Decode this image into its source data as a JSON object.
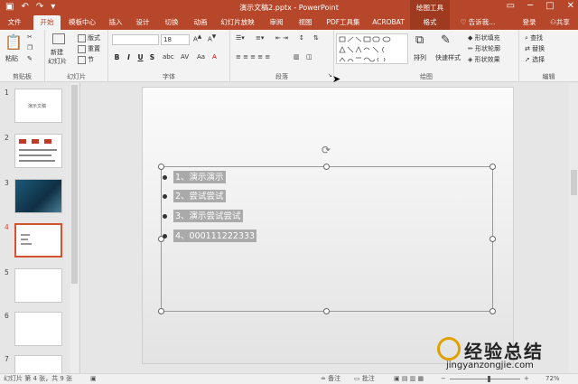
{
  "titlebar": {
    "save_icon": "save-icon",
    "undo": "↶",
    "redo": "↷",
    "title": "演示文稿2.pptx - PowerPoint",
    "context": "绘图工具"
  },
  "tabs": {
    "items": [
      {
        "label": "文件"
      },
      {
        "label": "开始",
        "active": true
      },
      {
        "label": "模板中心"
      },
      {
        "label": "插入"
      },
      {
        "label": "设计"
      },
      {
        "label": "切换"
      },
      {
        "label": "动画"
      },
      {
        "label": "幻灯片放映"
      },
      {
        "label": "审阅"
      },
      {
        "label": "视图"
      },
      {
        "label": "PDF工具集"
      },
      {
        "label": "ACROBAT"
      },
      {
        "label": "格式",
        "context": true
      }
    ],
    "tell": "告诉我...",
    "login": "登录",
    "share": "共享"
  },
  "ribbon": {
    "clipboard": {
      "paste": "粘贴",
      "label": "剪贴板"
    },
    "slides": {
      "new": "新建",
      "new2": "幻灯片",
      "layout": "版式",
      "reset": "重置",
      "section": "节",
      "label": "幻灯片"
    },
    "font": {
      "size": "18",
      "b": "B",
      "i": "I",
      "u": "U",
      "s": "S",
      "label": "字体"
    },
    "paragraph": {
      "label": "段落"
    },
    "drawing": {
      "arrange": "排列",
      "quick": "快速样式",
      "fill": "形状填充",
      "outline": "形状轮廓",
      "effect": "形状效果",
      "label": "绘图"
    },
    "editing": {
      "find": "查找",
      "replace": "替换",
      "select": "选择",
      "label": "编辑"
    }
  },
  "slides_panel": {
    "items": [
      {
        "num": "1",
        "caption": "演示文稿"
      },
      {
        "num": "2"
      },
      {
        "num": "3"
      },
      {
        "num": "4"
      },
      {
        "num": "5"
      },
      {
        "num": "6"
      },
      {
        "num": "7"
      }
    ],
    "selected": "4"
  },
  "slide": {
    "bullets": [
      "1、演示演示",
      "2、尝试尝试",
      "3、演示尝试尝试",
      "4、000111222333"
    ]
  },
  "status": {
    "slide": "幻灯片 第 4 张，共 9 张",
    "notes": "备注",
    "comments": "批注",
    "zoom": "72%"
  },
  "watermark": {
    "title": "经验总结",
    "url": "jingyanzongjie.com"
  }
}
